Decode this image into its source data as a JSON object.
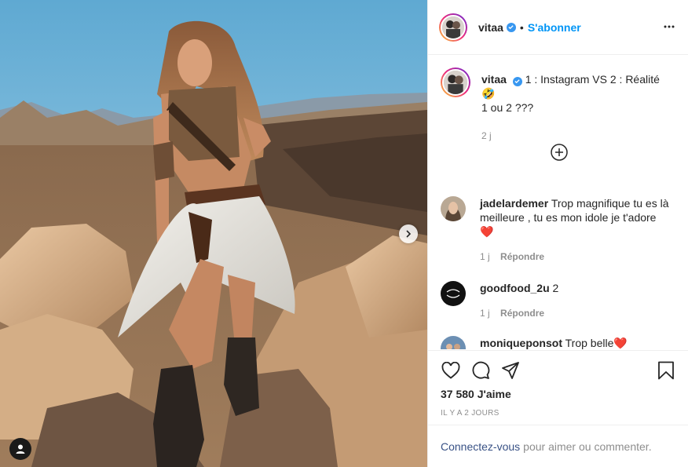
{
  "post_author": {
    "username": "vitaa",
    "verified": true,
    "follow_label": "S'abonner",
    "separator": "•"
  },
  "caption": {
    "username": "vitaa",
    "line1": "1 : Instagram VS 2 : Réalité 🤣",
    "line2": "1 ou 2 ???",
    "time": "2 j"
  },
  "comments": [
    {
      "username": "jadelardemer",
      "text": "Trop magnifique tu es là meilleure , tu es mon idole je t'adore",
      "emoji": "❤️",
      "time": "1 j",
      "reply": "Répondre"
    },
    {
      "username": "goodfood_2u",
      "text": "2",
      "time": "1 j",
      "reply": "Répondre"
    },
    {
      "username": "moniqueponsot",
      "text": "Trop belle",
      "emoji": "❤️"
    }
  ],
  "likes": "37 580 J'aime",
  "posted_ago": "IL Y A 2 JOURS",
  "login_prompt": {
    "link": "Connectez-vous",
    "text": "pour aimer ou commenter."
  },
  "colors": {
    "accent": "#0095f6",
    "verified": "#3897f0",
    "border": "#efefef",
    "muted": "#8e8e8e",
    "heart": "#ed4956"
  },
  "icons": [
    "more-icon",
    "add-comment-icon",
    "like-icon",
    "comment-icon",
    "share-icon",
    "save-icon",
    "carousel-next-icon",
    "user-tag-icon"
  ]
}
